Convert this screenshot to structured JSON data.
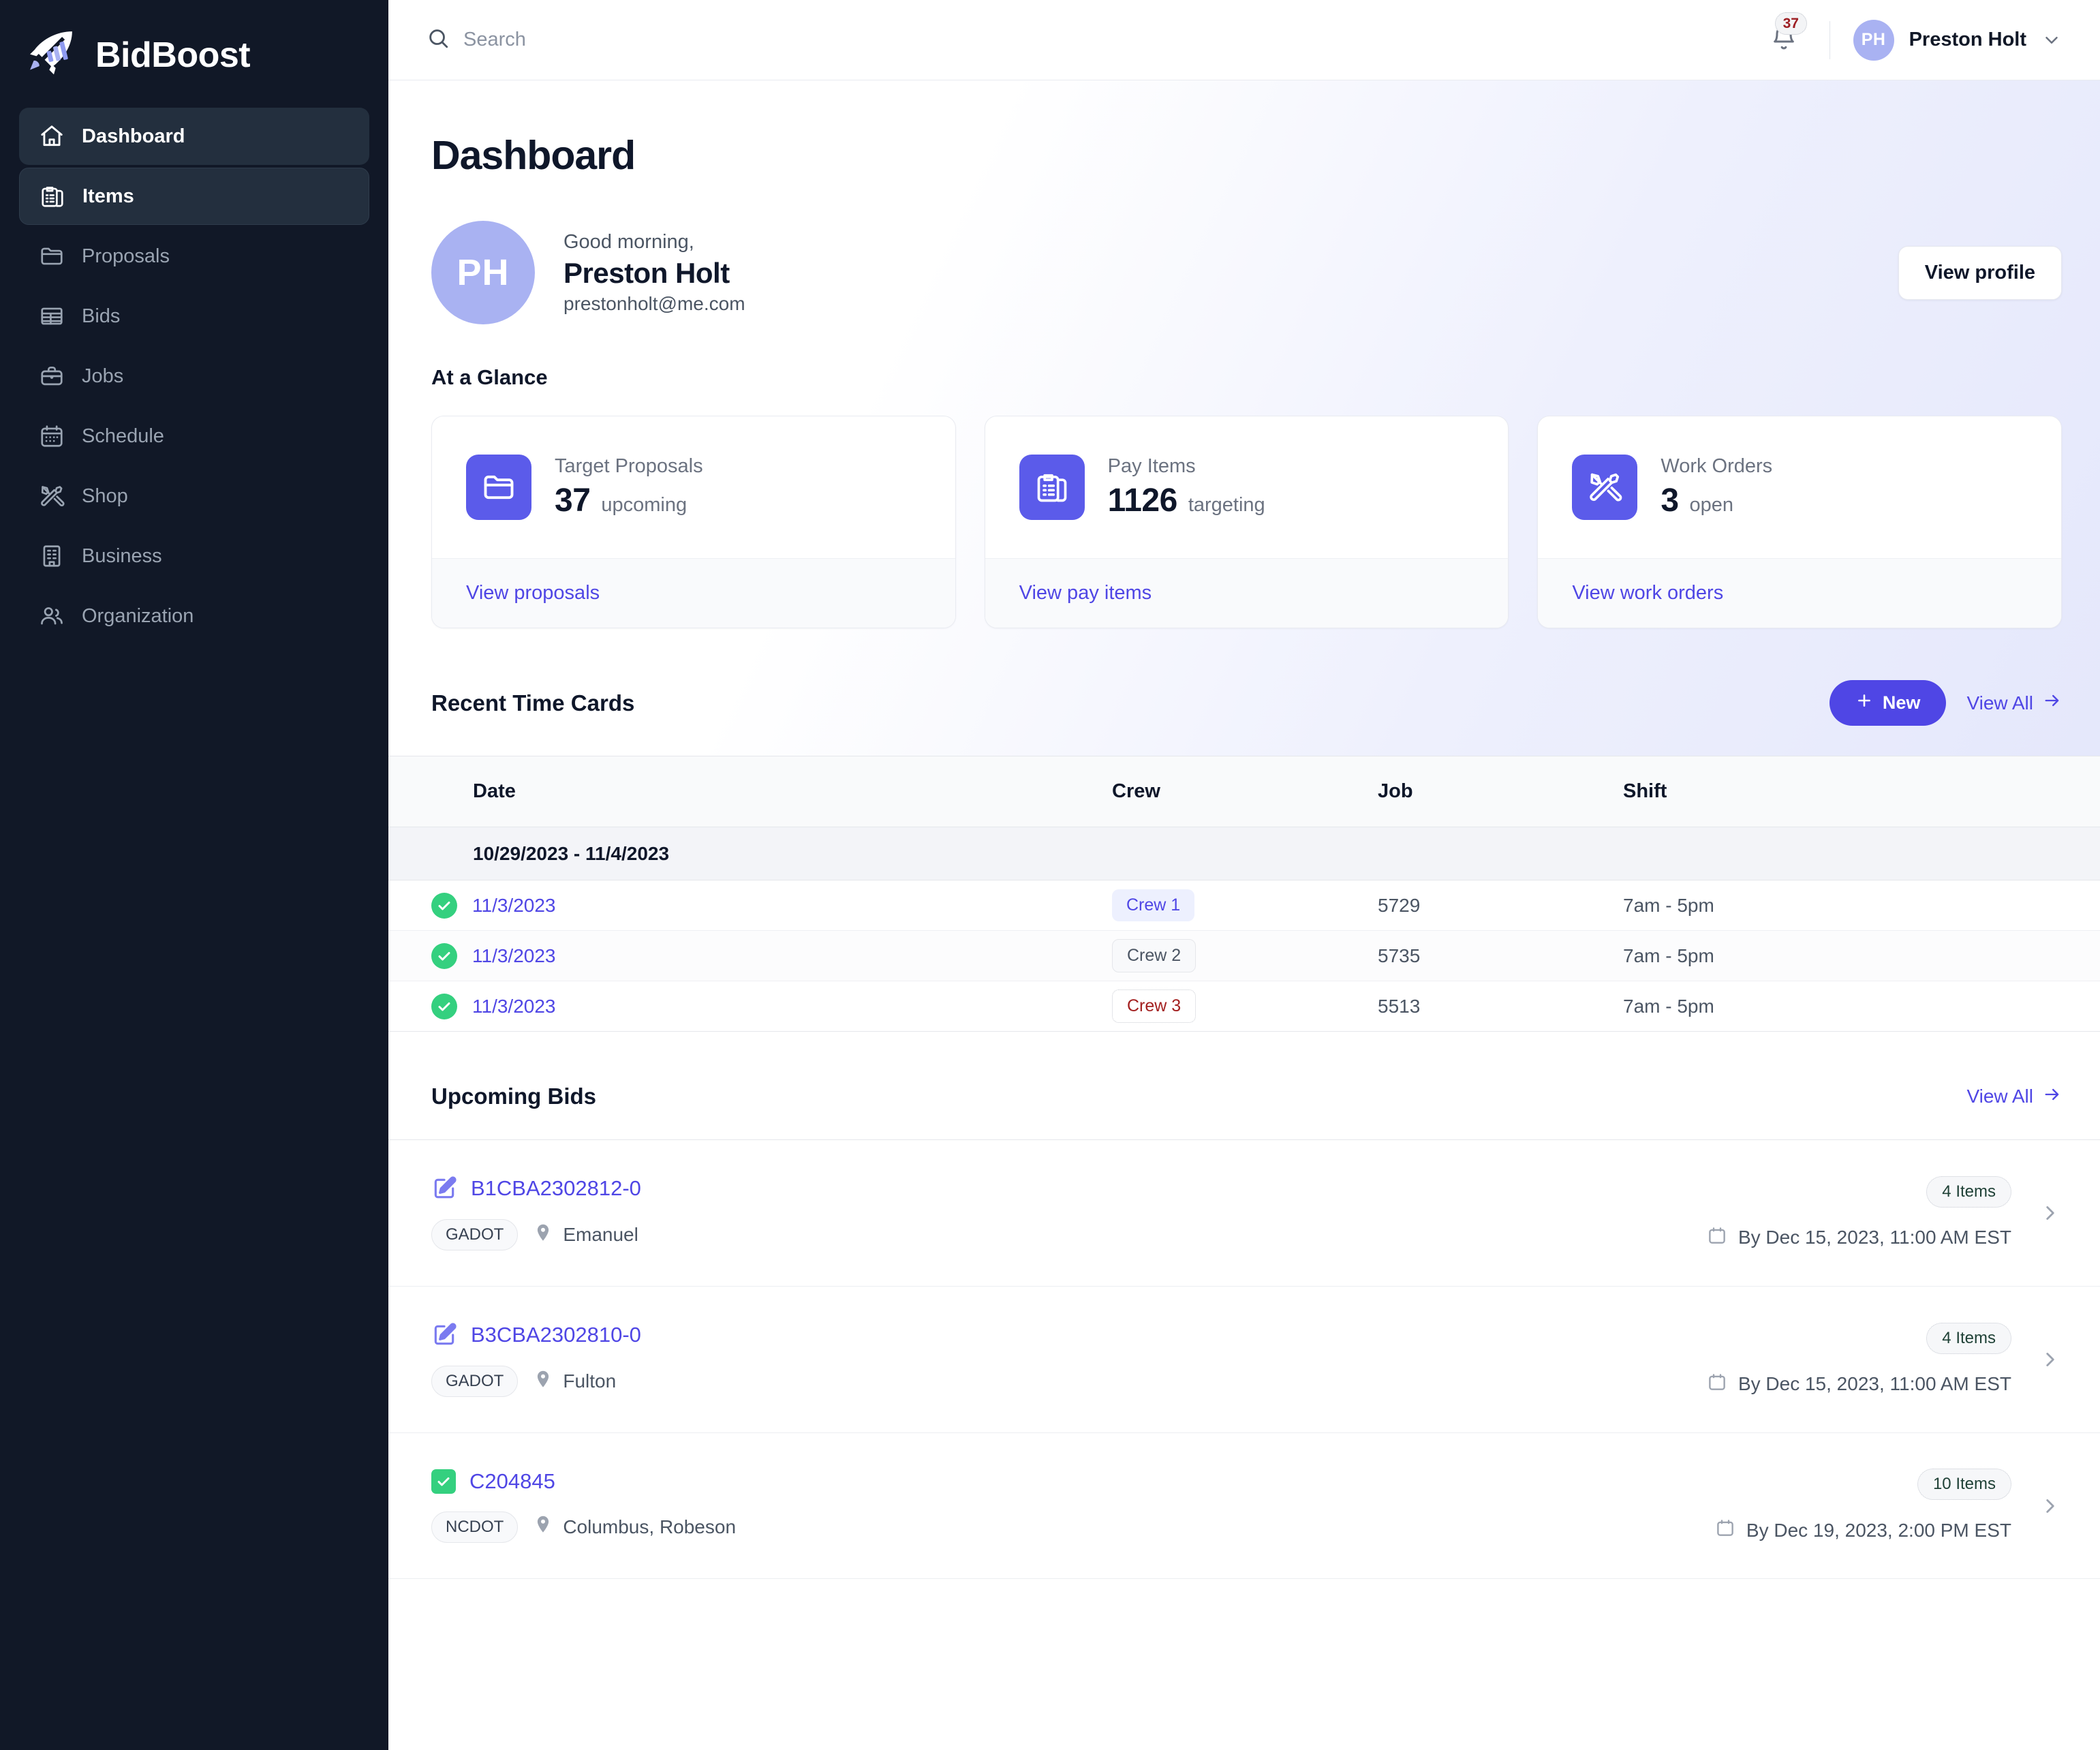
{
  "brand": {
    "name": "BidBoost"
  },
  "sidebar": {
    "items": [
      {
        "label": "Dashboard",
        "icon": "home-icon",
        "state": "active"
      },
      {
        "label": "Items",
        "icon": "clipboard-list-icon",
        "state": "active2"
      },
      {
        "label": "Proposals",
        "icon": "folder-icon",
        "state": ""
      },
      {
        "label": "Bids",
        "icon": "table-icon",
        "state": ""
      },
      {
        "label": "Jobs",
        "icon": "briefcase-icon",
        "state": ""
      },
      {
        "label": "Schedule",
        "icon": "calendar-icon",
        "state": ""
      },
      {
        "label": "Shop",
        "icon": "tools-icon",
        "state": ""
      },
      {
        "label": "Business",
        "icon": "building-icon",
        "state": ""
      },
      {
        "label": "Organization",
        "icon": "users-icon",
        "state": ""
      }
    ]
  },
  "topbar": {
    "search_placeholder": "Search",
    "search_value": "",
    "notification_count": "37",
    "user_initials": "PH",
    "user_name": "Preston Holt"
  },
  "page": {
    "title": "Dashboard"
  },
  "profile": {
    "initials": "PH",
    "greeting": "Good morning,",
    "name": "Preston Holt",
    "email": "prestonholt@me.com",
    "button_label": "View profile"
  },
  "glance": {
    "heading": "At a Glance",
    "cards": [
      {
        "icon": "folder-icon",
        "label": "Target Proposals",
        "value": "37",
        "suffix": "upcoming",
        "link": "View proposals"
      },
      {
        "icon": "clipboard-list-icon",
        "label": "Pay Items",
        "value": "1126",
        "suffix": "targeting",
        "link": "View pay items"
      },
      {
        "icon": "tools-icon",
        "label": "Work Orders",
        "value": "3",
        "suffix": "open",
        "link": "View work orders"
      }
    ]
  },
  "time_cards": {
    "title": "Recent Time Cards",
    "new_label": "New",
    "view_all_label": "View All",
    "columns": [
      "Date",
      "Crew",
      "Job",
      "Shift"
    ],
    "group_label": "10/29/2023 - 11/4/2023",
    "rows": [
      {
        "status": "complete",
        "date": "11/3/2023",
        "crew": "Crew 1",
        "crew_style": "crew-indigo",
        "job": "5729",
        "shift": "7am - 5pm"
      },
      {
        "status": "complete",
        "date": "11/3/2023",
        "crew": "Crew 2",
        "crew_style": "crew-gray",
        "job": "5735",
        "shift": "7am - 5pm"
      },
      {
        "status": "complete",
        "date": "11/3/2023",
        "crew": "Crew 3",
        "crew_style": "crew-red",
        "job": "5513",
        "shift": "7am - 5pm"
      }
    ]
  },
  "upcoming_bids": {
    "title": "Upcoming Bids",
    "view_all_label": "View All",
    "rows": [
      {
        "icon": "edit-square-icon",
        "id": "B1CBA2302812-0",
        "agency": "GADOT",
        "location": "Emanuel",
        "items": "4 Items",
        "due": "By Dec 15, 2023, 11:00 AM EST"
      },
      {
        "icon": "edit-square-icon",
        "id": "B3CBA2302810-0",
        "agency": "GADOT",
        "location": "Fulton",
        "items": "4 Items",
        "due": "By Dec 15, 2023, 11:00 AM EST"
      },
      {
        "icon": "check-square-icon",
        "id": "C204845",
        "agency": "NCDOT",
        "location": "Columbus, Robeson",
        "items": "10 Items",
        "due": "By Dec 19, 2023, 2:00 PM EST"
      }
    ]
  },
  "colors": {
    "sidebar_bg": "#111827",
    "accent": "#4f46e5",
    "icon_tile": "#5b5bea",
    "avatar": "#a9b2f2",
    "success": "#34d07f",
    "danger": "#a32020"
  }
}
